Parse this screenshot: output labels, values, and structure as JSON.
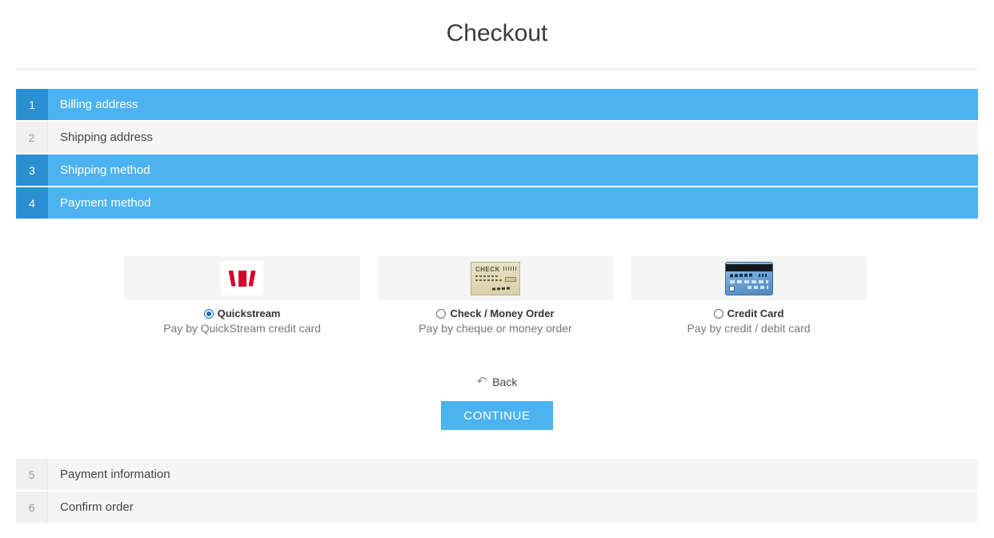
{
  "header": {
    "title": "Checkout"
  },
  "steps_top": [
    {
      "number": "1",
      "label": "Billing address",
      "state": "active"
    },
    {
      "number": "2",
      "label": "Shipping address",
      "state": "inactive"
    },
    {
      "number": "3",
      "label": "Shipping method",
      "state": "active"
    },
    {
      "number": "4",
      "label": "Payment method",
      "state": "active"
    }
  ],
  "steps_bottom": [
    {
      "number": "5",
      "label": "Payment information",
      "state": "inactive"
    },
    {
      "number": "6",
      "label": "Confirm order",
      "state": "inactive"
    }
  ],
  "payment_methods": [
    {
      "icon": "westpac-quickstream-logo",
      "label": "Quickstream",
      "description": "Pay by QuickStream credit card",
      "selected": true
    },
    {
      "icon": "check-image",
      "label": "Check / Money Order",
      "description": "Pay by cheque or money order",
      "selected": false
    },
    {
      "icon": "credit-card-image",
      "label": "Credit Card",
      "description": "Pay by credit / debit card",
      "selected": false
    }
  ],
  "check_thumb": {
    "word": "CHECK"
  },
  "actions": {
    "back_label": "Back",
    "back_icon": "↶",
    "continue_label": "CONTINUE"
  },
  "colors": {
    "active_row": "#4db2f0",
    "active_badge": "#2a8fd0",
    "inactive_row": "#f5f5f5",
    "button": "#4db2f0",
    "radio_selected": "#1568c0",
    "logo_red": "#d5002b"
  }
}
